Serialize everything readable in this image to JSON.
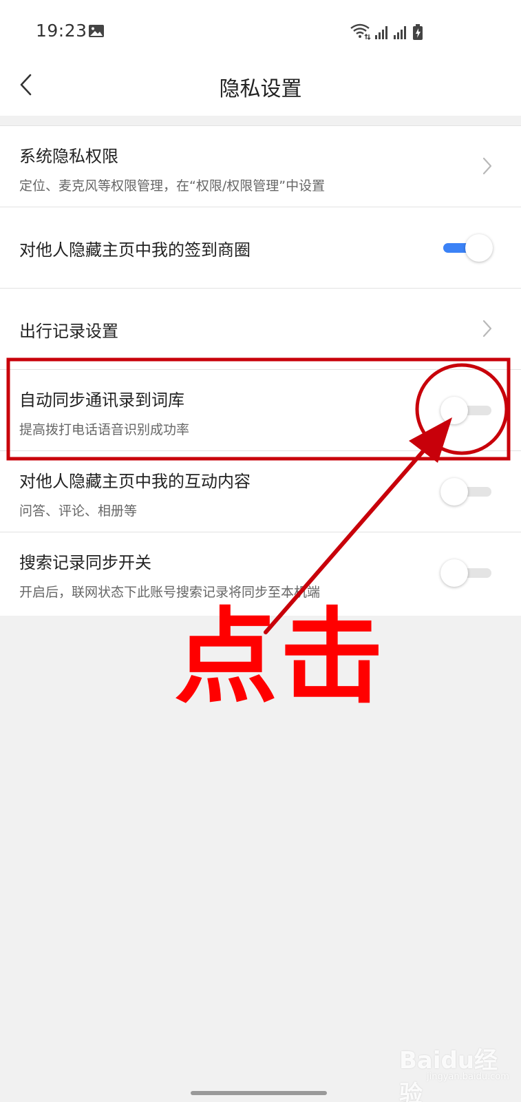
{
  "status_bar": {
    "time": "19:23",
    "left_icons": [
      "gallery-icon"
    ],
    "right_icons": [
      "wifi-icon",
      "signal-icon",
      "signal-icon",
      "battery-charging-icon"
    ]
  },
  "header": {
    "title": "隐私设置",
    "back_icon": "chevron-left-icon"
  },
  "settings": [
    {
      "title": "系统隐私权限",
      "subtitle": "定位、麦克风等权限管理，在“权限/权限管理”中设置",
      "control": "chevron"
    },
    {
      "title": "对他人隐藏主页中我的签到商圈",
      "control": "toggle",
      "on": true
    },
    {
      "title": "出行记录设置",
      "control": "chevron"
    },
    {
      "title": "自动同步通讯录到词库",
      "subtitle": "提高拨打电话语音识别成功率",
      "control": "toggle",
      "on": false
    },
    {
      "title": "对他人隐藏主页中我的互动内容",
      "subtitle": "问答、评论、相册等",
      "control": "toggle",
      "on": false
    },
    {
      "title": "搜索记录同步开关",
      "subtitle": "开启后，联网状态下此账号搜索记录将同步至本机端",
      "control": "toggle",
      "on": false
    }
  ],
  "annotation": {
    "text": "点击",
    "color": "#ff0000",
    "box_color": "#c8000a"
  },
  "watermark": {
    "brand": "Baidu经验",
    "url": "jingyan.baidu.com"
  },
  "colors": {
    "toggle_on": "#3b82f6",
    "toggle_track_off": "#e4e4e4",
    "background": "#f1f1f1"
  }
}
